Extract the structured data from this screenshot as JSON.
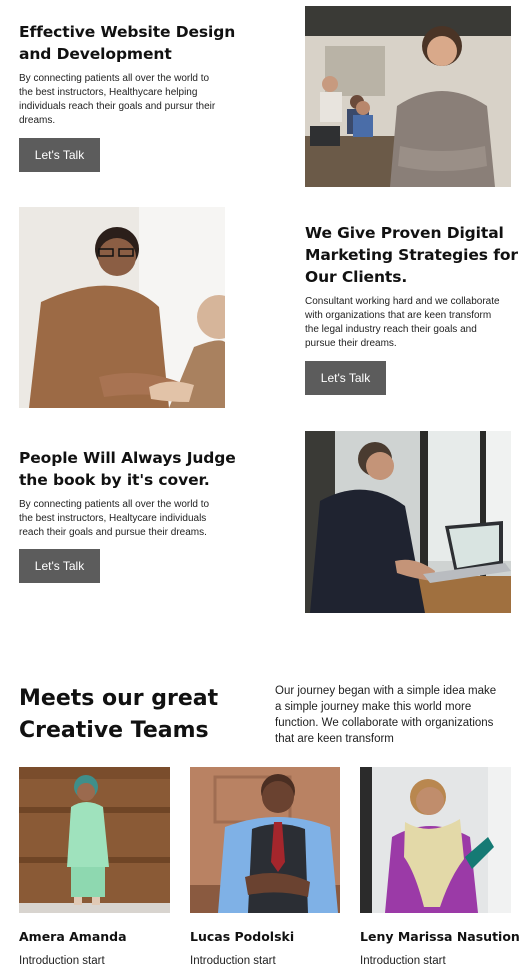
{
  "features": [
    {
      "title_line1": "Effective Website Design",
      "title_line2": "and Development",
      "text_line1": "By connecting patients all over the world to",
      "text_line2": "the best instructors, Healthycare helping",
      "text_line3": "individuals reach their goals and pursur their",
      "text_line4": "dreams.",
      "button": "Let's Talk"
    },
    {
      "title_line1": "We Give Proven Digital",
      "title_line2": "Marketing Strategies for",
      "title_line3": "Our Clients.",
      "text_line1": "Consultant working hard and we collaborate",
      "text_line2": "with organizations that are keen transform",
      "text_line3": "the legal industry reach their goals and",
      "text_line4": "pursue their dreams.",
      "button": "Let's Talk"
    },
    {
      "title_line1": "People Will Always Judge",
      "title_line2": "the book by it's cover.",
      "text_line1": "By connecting patients all over the world to",
      "text_line2": "the best instructors, Healtycare individuals",
      "text_line3": "reach their goals and pursue their dreams.",
      "button": "Let's Talk"
    }
  ],
  "teams": {
    "title_line1": "Meets our great",
    "title_line2": "Creative Teams",
    "text_line1": "Our journey began with a simple idea make",
    "text_line2": "a simple journey make this world more",
    "text_line3": "function. We collaborate with organizations",
    "text_line4": "that are keen transform",
    "members": [
      {
        "name": "Amera Amanda",
        "intro": "Introduction start"
      },
      {
        "name": "Lucas Podolski",
        "intro": "Introduction start"
      },
      {
        "name": "Leny Marissa Nasution",
        "intro": "Introduction start"
      }
    ]
  },
  "colors": {
    "button_bg": "#5c5c5c",
    "button_text": "#ffffff",
    "heading": "#111111"
  }
}
